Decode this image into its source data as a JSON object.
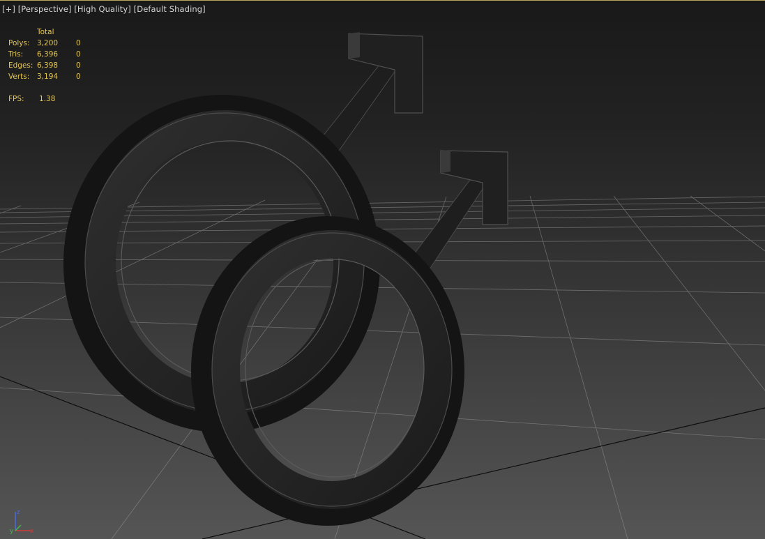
{
  "viewport": {
    "label_plus": "[+]",
    "label_view": "[Perspective]",
    "label_quality": "[High Quality]",
    "label_shading": "[Default Shading]"
  },
  "stats": {
    "header_total": "Total",
    "rows": [
      {
        "label": "Polys:",
        "total": "3,200",
        "selected": "0"
      },
      {
        "label": "Tris:",
        "total": "6,396",
        "selected": "0"
      },
      {
        "label": "Edges:",
        "total": "6,398",
        "selected": "0"
      },
      {
        "label": "Verts:",
        "total": "3,194",
        "selected": "0"
      }
    ],
    "fps_label": "FPS:",
    "fps_value": "1.38"
  },
  "gizmo": {
    "x": "x",
    "y": "y",
    "z": "z"
  },
  "colors": {
    "stats_text": "#e5c74f",
    "label_text": "#d6d6d6",
    "axis_x": "#d23a3a",
    "axis_y": "#4cb84c",
    "axis_z": "#4a6be0",
    "active_border": "#b9a25a"
  }
}
